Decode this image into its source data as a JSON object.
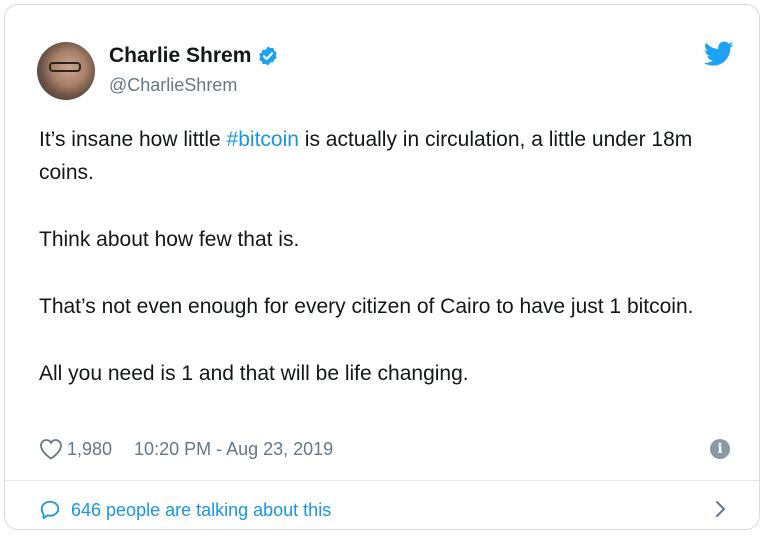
{
  "author": {
    "name": "Charlie Shrem",
    "handle": "@CharlieShrem"
  },
  "tweet": {
    "line1_pre": "It’s insane how little ",
    "hashtag": "#bitcoin",
    "line1_post": " is actually in circulation, a little under 18m coins.",
    "paragraph2": "Think about how few that is.",
    "paragraph3": "That’s not even enough for every citizen of Cairo to have just 1 bitcoin.",
    "paragraph4": "All you need is 1 and that will be life changing."
  },
  "meta": {
    "likes": "1,980",
    "timestamp": "10:20 PM - Aug 23, 2019"
  },
  "footer": {
    "talking_text": "646 people are talking about this"
  },
  "colors": {
    "accent": "#1b95e0",
    "muted": "#657786",
    "verified": "#1da1f2"
  },
  "icons": [
    "verified-badge-icon",
    "twitter-bird-icon",
    "heart-icon",
    "info-icon",
    "speech-bubble-icon",
    "chevron-right-icon"
  ]
}
